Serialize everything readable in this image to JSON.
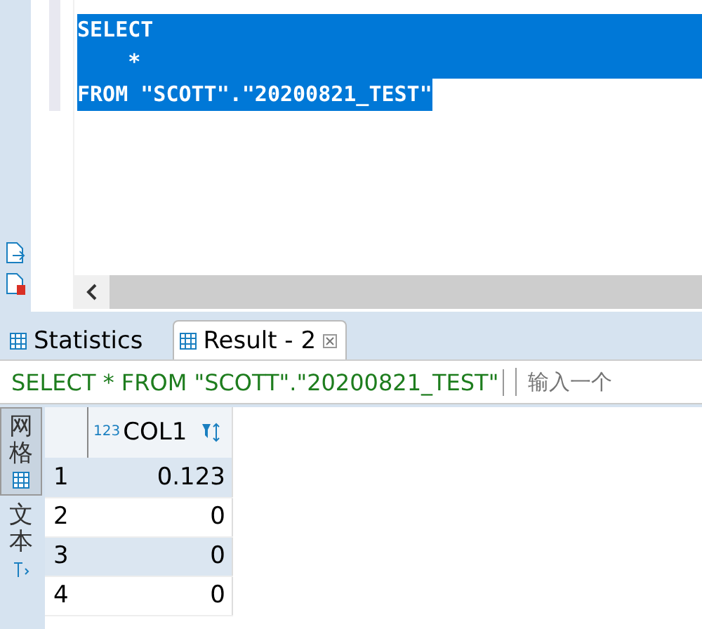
{
  "editor": {
    "lines": [
      "SELECT",
      "    *",
      "FROM \"SCOTT\".\"20200821_TEST\""
    ]
  },
  "result_tabs": [
    {
      "label": "Statistics",
      "selected": false,
      "closable": false
    },
    {
      "label": "Result - 2",
      "selected": true,
      "closable": true
    }
  ],
  "filter_bar": {
    "query": "SELECT * FROM \"SCOTT\".\"20200821_TEST\"",
    "placeholder": "输入一个"
  },
  "view_tabs": [
    {
      "label": "网格",
      "selected": true,
      "kind": "grid"
    },
    {
      "label": "文本",
      "selected": false,
      "kind": "text"
    }
  ],
  "table": {
    "columns": [
      {
        "type_badge": "123",
        "name": "COL1"
      }
    ],
    "rows": [
      {
        "number": "1",
        "cells": [
          "0.123"
        ]
      },
      {
        "number": "2",
        "cells": [
          "0"
        ]
      },
      {
        "number": "3",
        "cells": [
          "0"
        ]
      },
      {
        "number": "4",
        "cells": [
          "0"
        ]
      }
    ]
  }
}
